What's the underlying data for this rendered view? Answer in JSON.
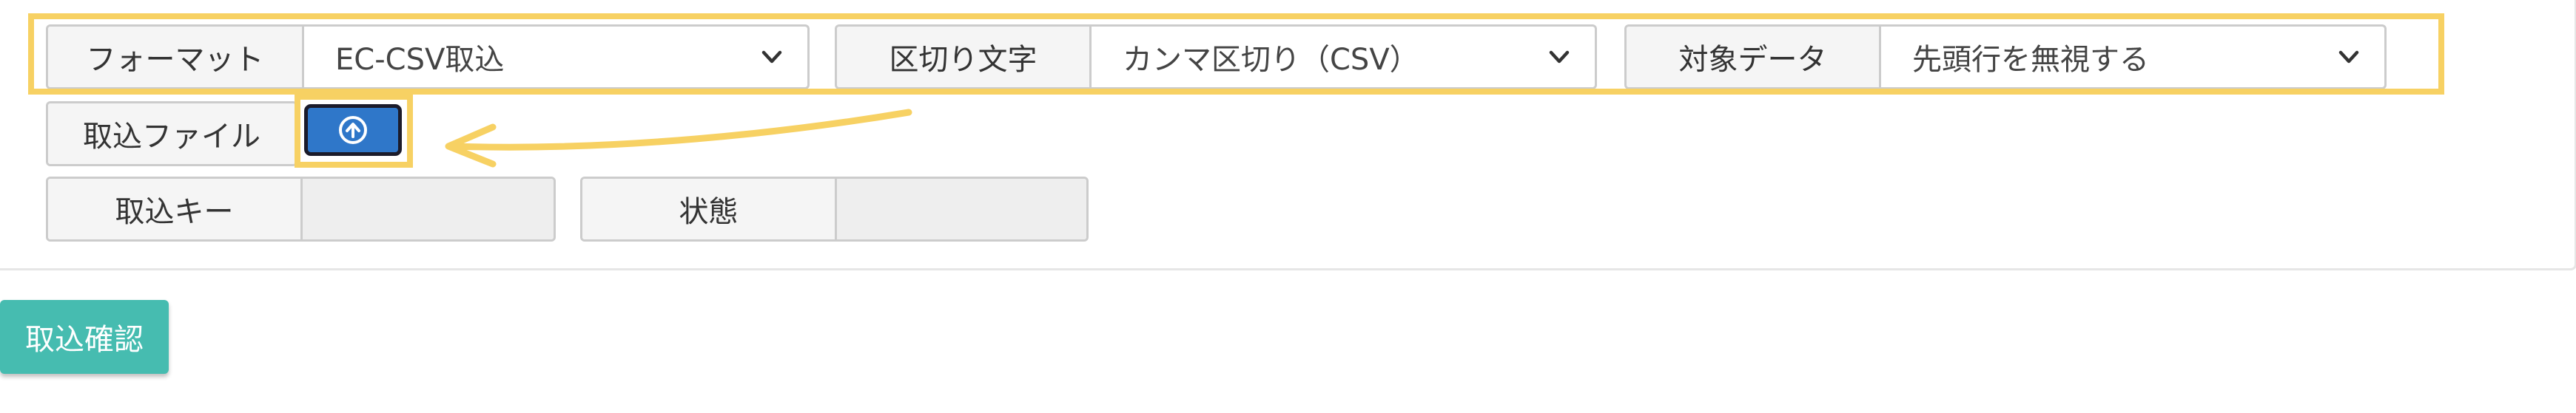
{
  "form": {
    "format": {
      "label": "フォーマット",
      "value": "EC-CSV取込"
    },
    "delimiter": {
      "label": "区切り文字",
      "value": "カンマ区切り（CSV）"
    },
    "target": {
      "label": "対象データ",
      "value": "先頭行を無視する"
    },
    "import_file": {
      "label": "取込ファイル",
      "upload_icon": "upload-circle-icon"
    },
    "import_key": {
      "label": "取込キー",
      "value": ""
    },
    "status": {
      "label": "状態",
      "value": ""
    }
  },
  "actions": {
    "confirm_label": "取込確認"
  },
  "annotations": {
    "highlight_color": "#f7d163"
  },
  "colors": {
    "upload_button": "#2f77c9",
    "confirm_button": "#46bcb0"
  }
}
